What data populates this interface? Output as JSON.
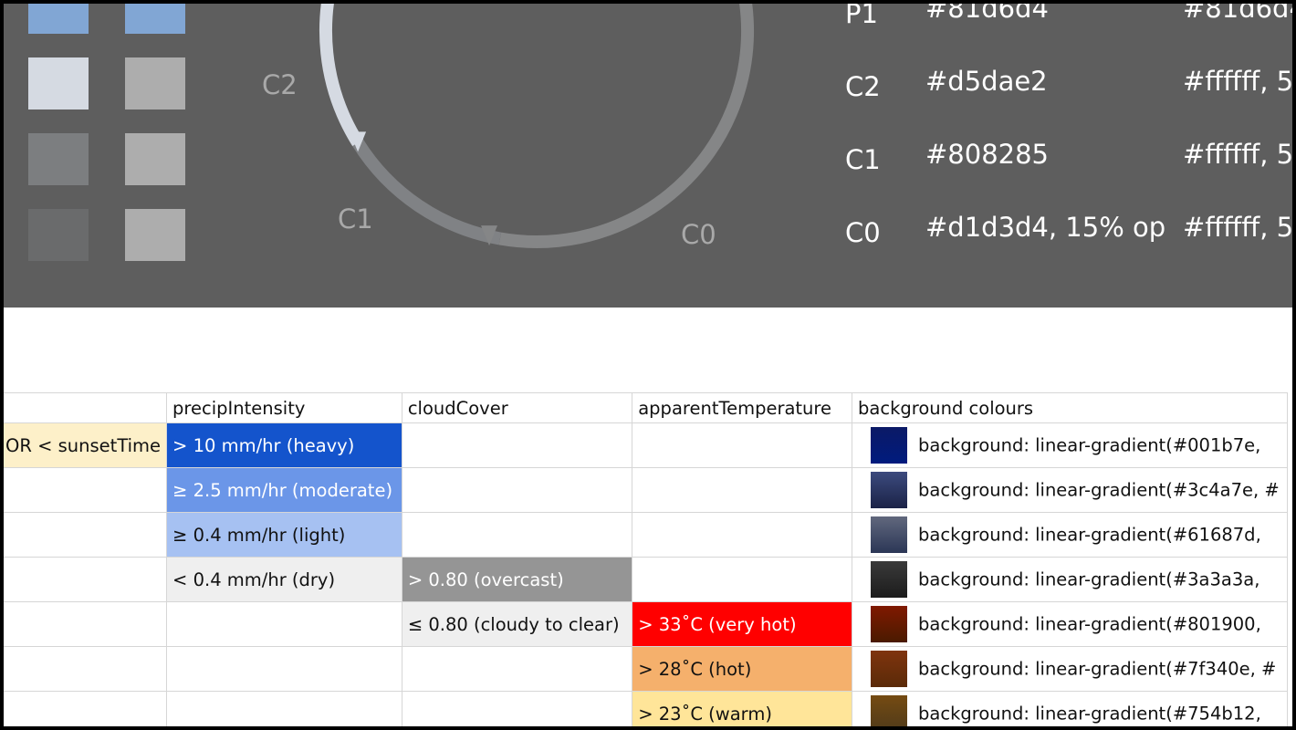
{
  "palette": {
    "swatches": [
      {
        "color": "#81a6d4"
      },
      {
        "color": "#81a6d4"
      },
      {
        "color": "#d5dae2"
      },
      {
        "color": "#adadad"
      },
      {
        "color": "#7c7e80"
      },
      {
        "color": "#adadad"
      },
      {
        "color": "#6a6b6c"
      },
      {
        "color": "#adadad"
      }
    ],
    "ring_labels": {
      "c2": "C2",
      "c1": "C1",
      "c0": "C0"
    },
    "ring_colors": {
      "p1": "#81a6d4",
      "c2": "#d5dae2",
      "c1": "#808285",
      "c0": "#858687"
    },
    "slots": [
      {
        "name": "P1",
        "bg": "#81d6d4",
        "fg": "#81d6d4"
      },
      {
        "name": "C2",
        "bg": "#d5dae2",
        "fg": "#ffffff, 5"
      },
      {
        "name": "C1",
        "bg": "#808285",
        "fg": "#ffffff, 5"
      },
      {
        "name": "C0",
        "bg": "#d1d3d4, 15% op",
        "fg": "#ffffff, 5"
      }
    ]
  },
  "table": {
    "headers": [
      "",
      "precipIntensity",
      "cloudCover",
      "apparentTemperature",
      "background colours"
    ],
    "rows": [
      {
        "time": "OR < sunsetTime",
        "time_color": "#fdf0c9",
        "precip": "> 10 mm/hr (heavy)",
        "precip_color": "#1454cc",
        "precip_text": "#ffffff",
        "cloud": "",
        "cloud_color": "",
        "cloud_text": "",
        "temp": "",
        "temp_color": "",
        "temp_text": "",
        "bg_swatch": [
          "#0b1a66",
          "#001b7e"
        ],
        "bg": "background: linear-gradient(#001b7e,"
      },
      {
        "time": "",
        "time_color": "",
        "precip": "≥ 2.5 mm/hr (moderate)",
        "precip_color": "#6b96e8",
        "precip_text": "#ffffff",
        "cloud": "",
        "cloud_color": "",
        "cloud_text": "",
        "temp": "",
        "temp_color": "",
        "temp_text": "",
        "bg_swatch": [
          "#3c4a7e",
          "#1b2347"
        ],
        "bg": "background: linear-gradient(#3c4a7e, #"
      },
      {
        "time": "",
        "time_color": "",
        "precip": "≥ 0.4 mm/hr (light)",
        "precip_color": "#a6c1f2",
        "precip_text": "#111111",
        "cloud": "",
        "cloud_color": "",
        "cloud_text": "",
        "temp": "",
        "temp_color": "",
        "temp_text": "",
        "bg_swatch": [
          "#61687d",
          "#2b3656"
        ],
        "bg": "background: linear-gradient(#61687d,"
      },
      {
        "time": "",
        "time_color": "",
        "precip": "< 0.4 mm/hr (dry)",
        "precip_color": "#efefef",
        "precip_text": "#111111",
        "cloud": "> 0.80 (overcast)",
        "cloud_color": "#959595",
        "cloud_text": "#ffffff",
        "temp": "",
        "temp_color": "",
        "temp_text": "",
        "bg_swatch": [
          "#3a3a3a",
          "#1c1c1c"
        ],
        "bg": "background: linear-gradient(#3a3a3a,"
      },
      {
        "time": "",
        "time_color": "",
        "precip": "",
        "precip_color": "",
        "precip_text": "",
        "cloud": "≤ 0.80 (cloudy to clear)",
        "cloud_color": "#efefef",
        "cloud_text": "#111111",
        "temp": "> 33˚C (very hot)",
        "temp_color": "#ff0000",
        "temp_text": "#ffffff",
        "bg_swatch": [
          "#801900",
          "#4a1a00"
        ],
        "bg": "background: linear-gradient(#801900,"
      },
      {
        "time": "",
        "time_color": "",
        "precip": "",
        "precip_color": "",
        "precip_text": "",
        "cloud": "",
        "cloud_color": "",
        "cloud_text": "",
        "temp": "> 28˚C (hot)",
        "temp_color": "#f5b06c",
        "temp_text": "#111111",
        "bg_swatch": [
          "#7f340e",
          "#5a2a08"
        ],
        "bg": "background: linear-gradient(#7f340e, #"
      },
      {
        "time": "",
        "time_color": "",
        "precip": "",
        "precip_color": "",
        "precip_text": "",
        "cloud": "",
        "cloud_color": "",
        "cloud_text": "",
        "temp": "> 23˚C (warm)",
        "temp_color": "#ffe599",
        "temp_text": "#111111",
        "bg_swatch": [
          "#754b12",
          "#4f3a1a"
        ],
        "bg": "background: linear-gradient(#754b12,"
      }
    ]
  }
}
